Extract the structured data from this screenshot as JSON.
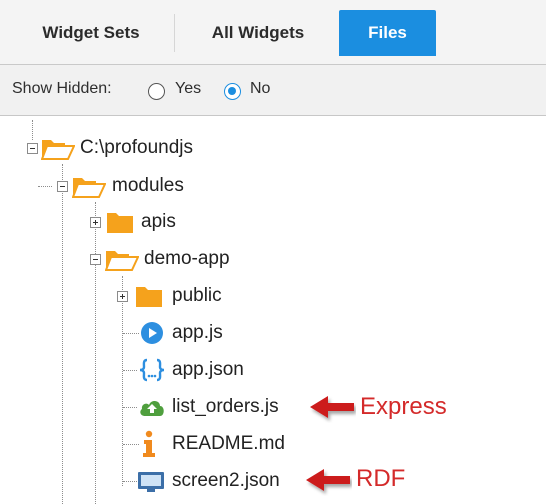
{
  "tabs": [
    {
      "label": "Widget Sets",
      "active": false
    },
    {
      "label": "All Widgets",
      "active": false
    },
    {
      "label": "Files",
      "active": true
    }
  ],
  "show_hidden": {
    "label": "Show Hidden:",
    "options": [
      "Yes",
      "No"
    ],
    "selected": "No"
  },
  "tree": {
    "root": {
      "label": "C:\\profoundjs",
      "expanded": true,
      "icon": "open-folder-icon"
    },
    "modules": {
      "label": "modules",
      "expanded": true,
      "icon": "open-folder-icon"
    },
    "apis": {
      "label": "apis",
      "expanded": false,
      "icon": "folder-icon"
    },
    "demo_app": {
      "label": "demo-app",
      "expanded": true,
      "icon": "open-folder-icon"
    },
    "public": {
      "label": "public",
      "expanded": false,
      "icon": "folder-icon"
    },
    "app_js": {
      "label": "app.js",
      "icon": "play-circle-icon"
    },
    "app_json": {
      "label": "app.json",
      "icon": "curly-braces-icon"
    },
    "list_orders": {
      "label": "list_orders.js",
      "icon": "cloud-upload-icon"
    },
    "readme": {
      "label": "README.md",
      "icon": "info-icon"
    },
    "screen2": {
      "label": "screen2.json",
      "icon": "monitor-icon"
    }
  },
  "annotations": {
    "express": "Express",
    "rdf": "RDF"
  },
  "colors": {
    "accent": "#1b8ee0",
    "folder": "#f5a21c",
    "annotation": "#d42a2a"
  }
}
